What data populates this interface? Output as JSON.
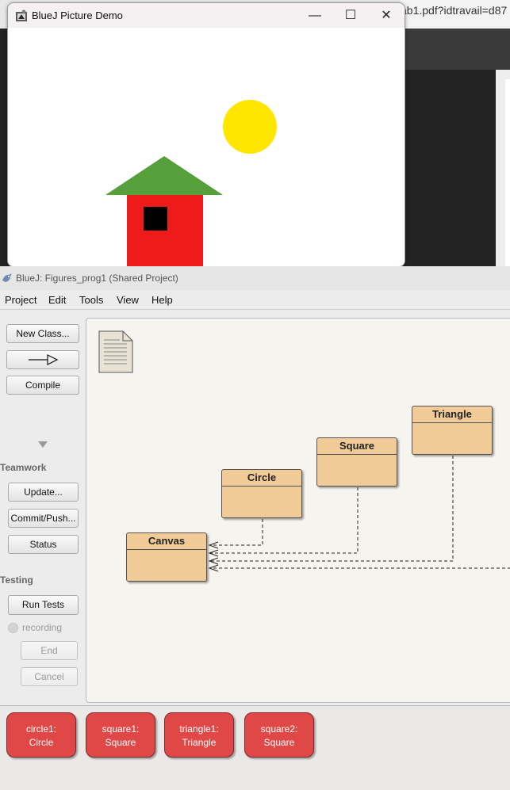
{
  "browser": {
    "url_fragment": "ab1.pdf?idtravail=d87"
  },
  "picture_demo": {
    "title": "BlueJ Picture Demo",
    "controls": {
      "minimize": "—",
      "maximize": "☐",
      "close": "✕"
    },
    "colors": {
      "sun": "#ffe600",
      "roof": "#55a03b",
      "wall": "#ee1b1b",
      "window": "#000000"
    }
  },
  "bluej": {
    "title": "BlueJ:  Figures_prog1 (Shared Project)",
    "menu": [
      "Project",
      "Edit",
      "Tools",
      "View",
      "Help"
    ],
    "buttons": {
      "new_class": "New Class...",
      "arrow": "—▷",
      "compile": "Compile"
    },
    "teamwork": {
      "label": "Teamwork",
      "update": "Update...",
      "commit": "Commit/Push...",
      "status": "Status"
    },
    "testing": {
      "label": "Testing",
      "run_tests": "Run Tests",
      "recording": "recording",
      "end": "End",
      "cancel": "Cancel"
    },
    "classes": [
      {
        "name": "Triangle"
      },
      {
        "name": "Square"
      },
      {
        "name": "Circle"
      },
      {
        "name": "Canvas"
      }
    ],
    "objects": [
      {
        "name": "circle1:",
        "type": "Circle"
      },
      {
        "name": "square1:",
        "type": "Square"
      },
      {
        "name": "triangle1:",
        "type": "Triangle"
      },
      {
        "name": "square2:",
        "type": "Square"
      }
    ],
    "colors": {
      "class_fill": "#f0cb98",
      "object_fill": "#e04848"
    }
  }
}
